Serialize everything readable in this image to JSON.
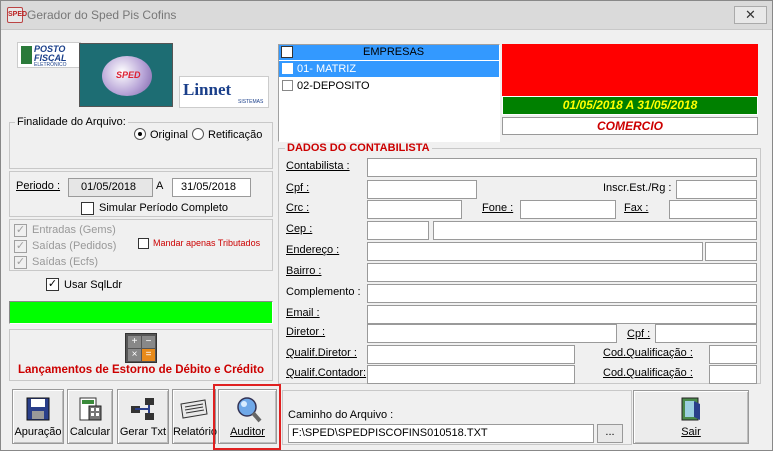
{
  "window": {
    "title": "Gerador do Sped Pis Cofins",
    "icon_label": "SPED"
  },
  "logos": {
    "posto_fiscal": "POSTO FISCAL",
    "posto_sub": "ELETRÔNICO",
    "sped": "SPED",
    "linnet": "Linnet",
    "linnet_sub": "SISTEMAS"
  },
  "finalidade": {
    "title": "Finalidade do Arquivo:",
    "original": "Original",
    "retificacao": "Retificação",
    "selected": "Original"
  },
  "periodo": {
    "label": "Periodo :",
    "start": "01/05/2018",
    "separator": "A",
    "end": "31/05/2018",
    "simular": "Simular Período Completo"
  },
  "options": {
    "entradas": "Entradas (Gems)",
    "saidas_pedidos": "Saídas (Pedidos)",
    "saidas_ecfs": "Saídas (Ecfs)",
    "mandar_tributados": "Mandar apenas Tributados",
    "usar_sqlldr": "Usar SqlLdr"
  },
  "estorno": {
    "label": "Lançamentos de Estorno de Débito e Crédito"
  },
  "empresas": {
    "header": "EMPRESAS",
    "items": [
      "01- MATRIZ",
      "02-DEPOSITO"
    ],
    "selected_index": 0
  },
  "status": {
    "period": "01/05/2018 A 31/05/2018",
    "type": "COMERCIO"
  },
  "contabilista": {
    "title": "DADOS DO CONTABILISTA",
    "contabilista": "Contabilista :",
    "cpf": "Cpf :",
    "inscr": "Inscr.Est./Rg :",
    "crc": "Crc :",
    "fone": "Fone :",
    "fax": "Fax :",
    "cep": "Cep :",
    "endereco": "Endereço :",
    "bairro": "Bairro :",
    "complemento": "Complemento :",
    "email": "Email :",
    "diretor": "Diretor :",
    "cpf2": "Cpf :",
    "qualif_diretor": "Qualif.Diretor :",
    "cod_qualif": "Cod.Qualificação :",
    "qualif_contador": "Qualif.Contador:",
    "cod_qualif2": "Cod.Qualificação :"
  },
  "caminho": {
    "label": "Caminho do Arquivo :",
    "value": "F:\\SPED\\SPEDPISCOFINS010518.TXT",
    "browse": "..."
  },
  "toolbar": {
    "apuracao": "Apuração",
    "calcular": "Calcular",
    "gerar_txt": "Gerar Txt",
    "relatorio": "Relatório",
    "auditor": "Auditor",
    "sair": "Sair"
  },
  "colors": {
    "red": "#ff0000",
    "green": "#008000",
    "bright_green": "#00ff00",
    "select_blue": "#3399ff",
    "dark_red": "#cc0000"
  }
}
